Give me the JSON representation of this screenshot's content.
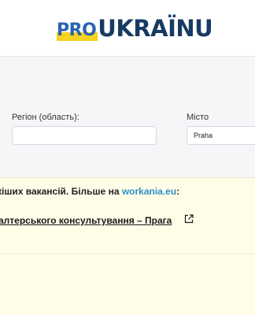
{
  "header": {
    "logo_pro": "PRO",
    "logo_main": "UKRAÏNU"
  },
  "filters": {
    "region_label": "Регіон (область):",
    "region_value": "",
    "city_label": "Місто",
    "city_value": "Praha"
  },
  "notice": {
    "text_before": "кіших вакансій. Більше на ",
    "link_text": "workania.eu",
    "text_after": ":",
    "job_title": "алтерського консультування – Прага"
  },
  "icons": {
    "external": "external-link-icon"
  }
}
